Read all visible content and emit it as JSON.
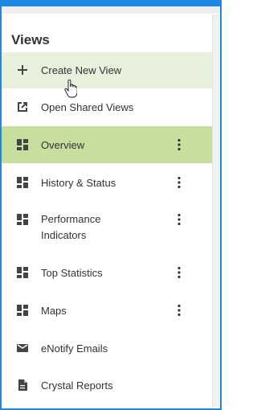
{
  "panel": {
    "title": "Views"
  },
  "items": [
    {
      "label": "Create New View",
      "icon": "plus-icon"
    },
    {
      "label": "Open Shared Views",
      "icon": "open-in-new-icon"
    },
    {
      "label": "Overview",
      "icon": "dashboard-icon",
      "selected": true,
      "has_menu": true
    },
    {
      "label": "History & Status",
      "icon": "dashboard-icon",
      "has_menu": true
    },
    {
      "label_line1": "Performance",
      "label_line2": "Indicators",
      "icon": "dashboard-icon",
      "has_menu": true
    },
    {
      "label": "Top Statistics",
      "icon": "dashboard-icon",
      "has_menu": true
    },
    {
      "label": "Maps",
      "icon": "dashboard-icon",
      "has_menu": true
    },
    {
      "label": "eNotify Emails",
      "icon": "email-icon"
    },
    {
      "label": "Crystal Reports",
      "icon": "document-icon"
    }
  ],
  "colors": {
    "accent_border": "#1e88e5",
    "hover_bg": "#e7f1dc",
    "selected_bg": "#c6df9f",
    "icon_color": "#444444"
  }
}
